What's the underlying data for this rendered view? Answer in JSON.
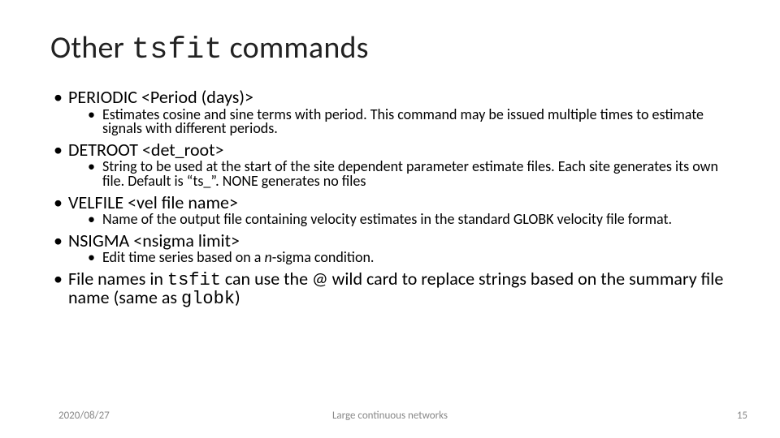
{
  "title": {
    "pre": "Other ",
    "code": "tsfit",
    "post": " commands"
  },
  "items": [
    {
      "label": "PERIODIC <Period (days)>",
      "sub": [
        "Estimates cosine and sine terms with period. This command may be issued multiple times to estimate signals with different periods."
      ]
    },
    {
      "label": "DETROOT <det_root>",
      "sub": [
        "String to be used at the start of the site dependent parameter estimate files.  Each site generates its own file. Default is “ts_”. NONE generates no files"
      ]
    },
    {
      "label": "VELFILE <vel file name>",
      "sub": [
        "Name of the output file containing velocity estimates in the standard GLOBK velocity file format."
      ]
    },
    {
      "label": "NSIGMA <nsigma limit>",
      "sub_rich": {
        "pre": "Edit time series based on a ",
        "italic": "n",
        "post": "-sigma condition."
      }
    }
  ],
  "last": {
    "pre": "File names in ",
    "code1": "tsfit",
    "mid": " can use the @ wild card to replace strings based on the summary file name (same as ",
    "code2": "globk",
    "post": ")"
  },
  "footer": {
    "date": "2020/08/27",
    "center": "Large continuous networks",
    "page": "15"
  }
}
